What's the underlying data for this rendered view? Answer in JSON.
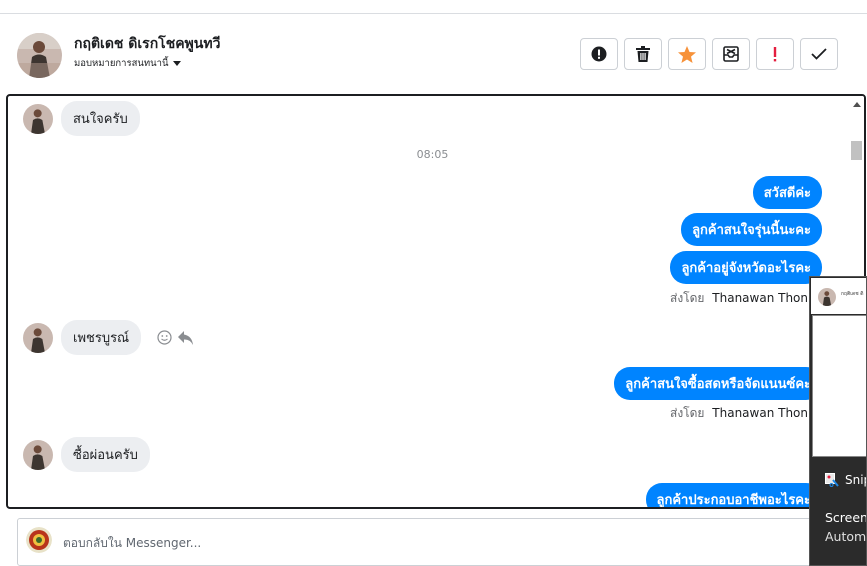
{
  "header": {
    "name": "กฤติเดช ดิเรกโชคพูนทวี",
    "assign_label": "มอบหมายการสนทนานี้"
  },
  "actions": [
    "alert-icon",
    "trash-icon",
    "star-icon",
    "archive-icon",
    "exclaim-icon",
    "check-icon"
  ],
  "colors": {
    "accent": "#0084ff",
    "star": "#f7923a",
    "danger": "#e41e3f"
  },
  "messages": {
    "in1": "สนใจครับ",
    "time1": "08:05",
    "out1": "สวัสดีค่ะ",
    "out2": "ลูกค้าสนใจรุ่นนี้นะคะ",
    "out3": "ลูกค้าอยู่จังหวัดอะไรคะ",
    "sent_prefix": "ส่งโดย",
    "sender": "Thanawan Thon",
    "in2": "เพชรบูรณ์",
    "out4": "ลูกค้าสนใจซื้อสดหรือจัดแนนซ์คะ",
    "in3": "ซื้อผ่อนครับ",
    "out5": "ลูกค้าประกอบอาชีพอะไรคะ"
  },
  "composer": {
    "placeholder": "ตอบกลับใน Messenger..."
  },
  "popup": {
    "thumb_text": "กฤติเดช ดิ",
    "app_label": "Snip",
    "line1": "Screen",
    "line2": "Autom"
  }
}
